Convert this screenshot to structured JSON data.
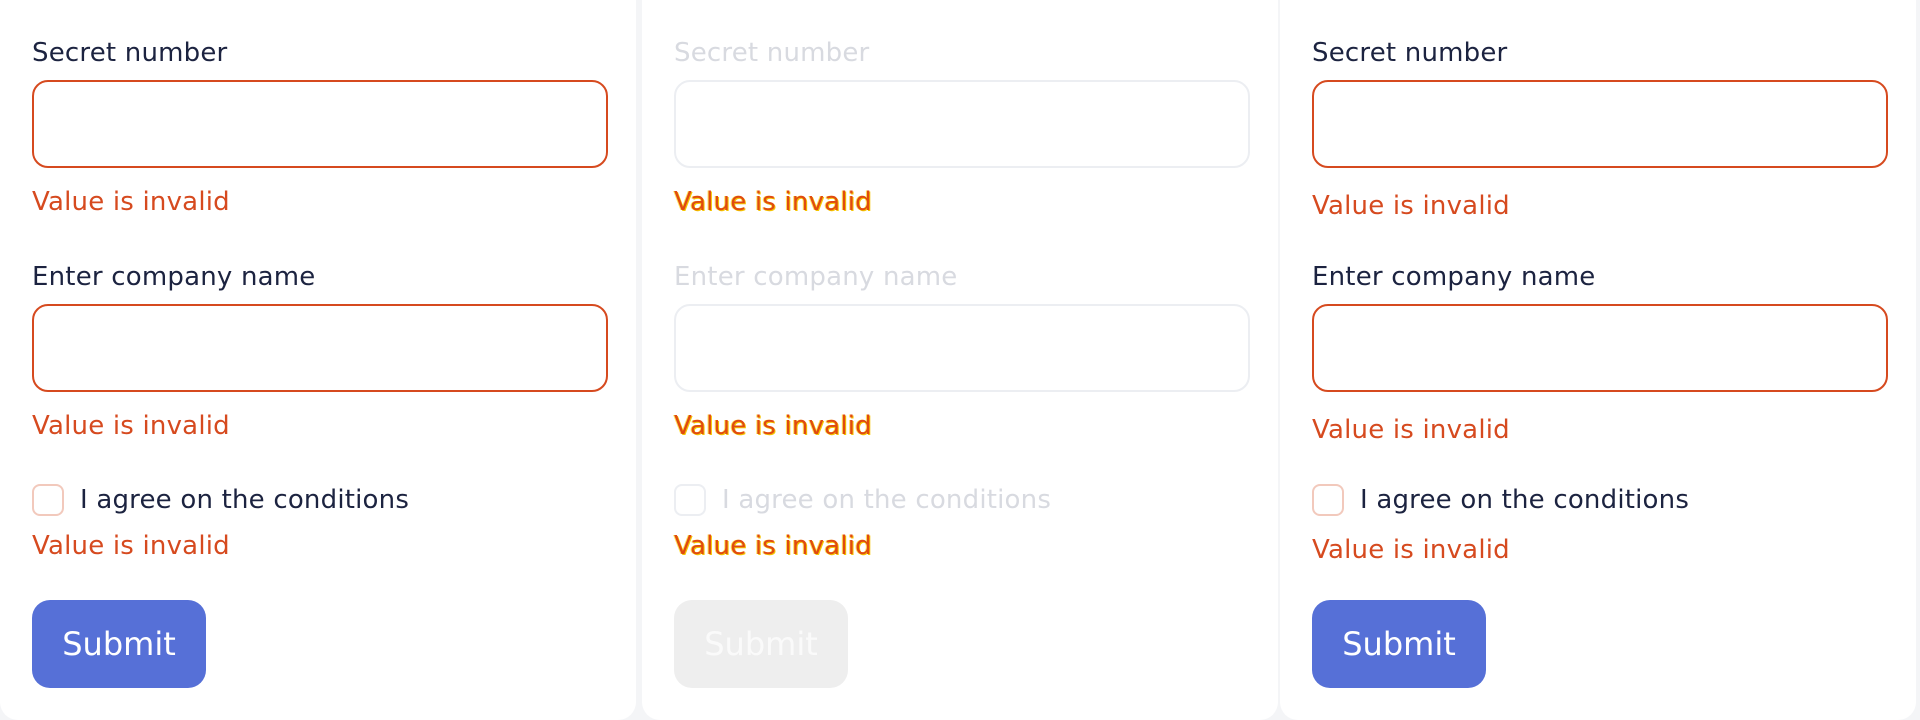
{
  "panels": [
    {
      "state": "invalid",
      "secret_label": "Secret number",
      "secret_error": "Value is invalid",
      "company_label": "Enter company name",
      "company_error": "Value is invalid",
      "agree_label": "I agree on the conditions",
      "agree_error": "Value is invalid",
      "submit_label": "Submit"
    },
    {
      "state": "disabled",
      "secret_label": "Secret number",
      "secret_error": "Value is invalid",
      "company_label": "Enter company name",
      "company_error": "Value is invalid",
      "agree_label": "I agree on the conditions",
      "agree_error": "Value is invalid",
      "submit_label": "Submit"
    },
    {
      "state": "invalid",
      "secret_label": "Secret number",
      "secret_error": "Value is invalid",
      "company_label": "Enter company name",
      "company_error": "Value is invalid",
      "agree_label": "I agree on the conditions",
      "agree_error": "Value is invalid",
      "submit_label": "Submit"
    }
  ],
  "colors": {
    "error": "#d64a1f",
    "primary_button": "#5670d7",
    "text": "#1c2340",
    "disabled_text": "#d8dae0",
    "disabled_button": "#eeeeee"
  }
}
